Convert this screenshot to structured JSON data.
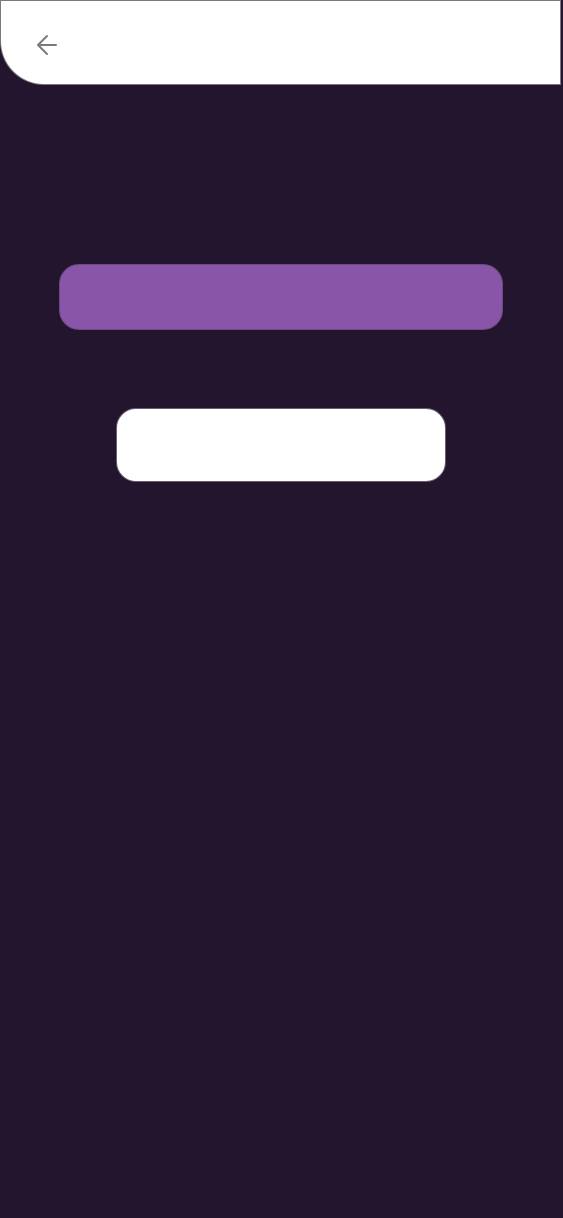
{
  "header": {
    "back_icon": "arrow-left-icon"
  },
  "primary_bar": {
    "label": ""
  },
  "white_field": {
    "value": ""
  },
  "colors": {
    "background": "#24152f",
    "header": "#ffffff",
    "accent": "#8955a9"
  }
}
